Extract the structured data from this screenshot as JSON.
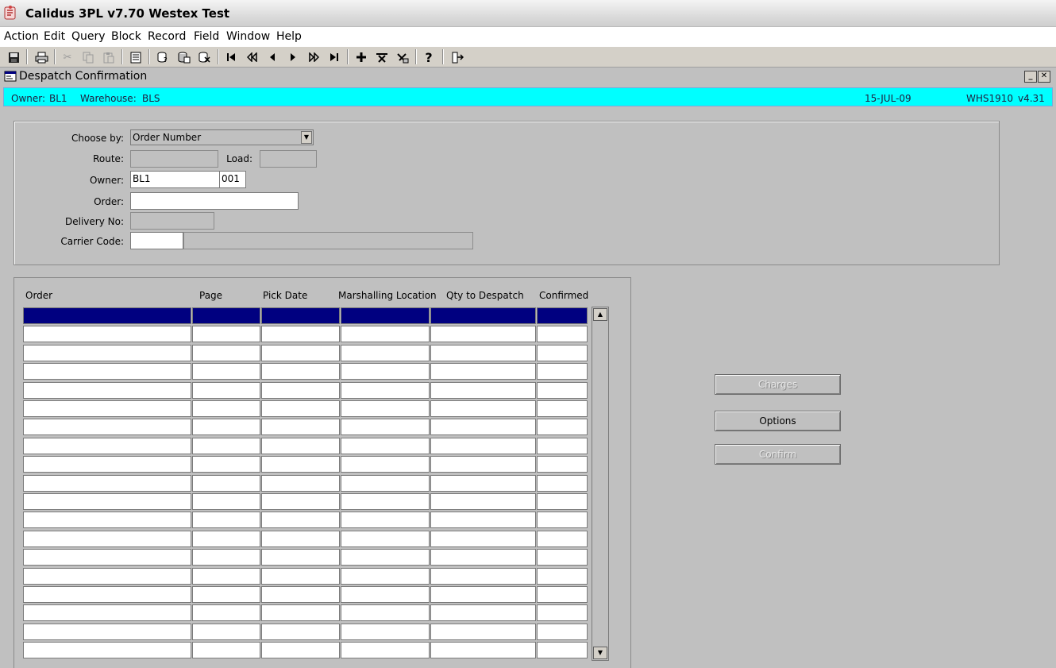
{
  "app": {
    "title": "Calidus 3PL v7.70 Westex Test"
  },
  "menu": [
    {
      "label": "Action"
    },
    {
      "label": "Edit"
    },
    {
      "label": "Query"
    },
    {
      "label": "Block"
    },
    {
      "label": "Record"
    },
    {
      "label": "Field"
    },
    {
      "label": "Window"
    },
    {
      "label": "Help"
    }
  ],
  "toolbar": {
    "icons": [
      "save-icon",
      "print-icon",
      "cut-icon",
      "copy-icon",
      "paste-icon",
      "list-icon",
      "enter-query-icon",
      "execute-query-icon",
      "cancel-query-icon",
      "first-record-icon",
      "previous-block-icon",
      "previous-record-icon",
      "next-record-icon",
      "next-block-icon",
      "last-record-icon",
      "insert-record-icon",
      "delete-record-icon",
      "clear-record-icon",
      "help-icon",
      "exit-icon"
    ],
    "help_glyph": "?"
  },
  "window": {
    "title": "Despatch Confirmation",
    "min_glyph": "_",
    "close_glyph": "✕"
  },
  "infobar": {
    "owner_label": "Owner:",
    "owner_value": "BL1",
    "warehouse_label": "Warehouse:",
    "warehouse_value": "BLS",
    "date": "15-JUL-09",
    "program": "WHS1910",
    "version": "v4.31"
  },
  "criteria": {
    "choose_by_label": "Choose by:",
    "choose_by_value": "Order Number",
    "route_label": "Route:",
    "route_value": "",
    "load_label": "Load:",
    "load_value": "",
    "owner_label": "Owner:",
    "owner_value": "BL1",
    "owner_code": "001",
    "order_label": "Order:",
    "order_value": "",
    "delivery_label": "Delivery No:",
    "delivery_value": "",
    "carrier_label": "Carrier Code:",
    "carrier_value": "",
    "carrier_desc": ""
  },
  "grid": {
    "columns": [
      "Order",
      "Page",
      "Pick Date",
      "Marshalling Location",
      "Qty to Despatch",
      "Confirmed"
    ],
    "row_count": 19,
    "selected_row": 0
  },
  "buttons": {
    "charges": "Charges",
    "options": "Options",
    "confirm": "Confirm"
  },
  "colors": {
    "infobar": "#00ffff",
    "selected_row": "#000080",
    "form_background": "#c0c0c0"
  }
}
